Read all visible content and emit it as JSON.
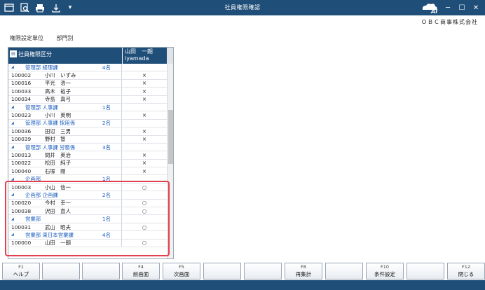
{
  "window": {
    "title": "社員権限確認"
  },
  "company_name": "ＯＢＣ商事株式会社",
  "setting": {
    "label": "権限設定単位",
    "value": "部門別"
  },
  "grid": {
    "header_left": "社員権限区分",
    "header_right_line1": "山田　一朗",
    "header_right_line2": "iyamada",
    "rows": [
      {
        "type": "group",
        "name": "管理部 経理課",
        "count": "4名",
        "mark": ""
      },
      {
        "type": "emp",
        "code": "100002",
        "name": "小川　いずみ",
        "mark": "×"
      },
      {
        "type": "emp",
        "code": "100016",
        "name": "平光　浩一",
        "mark": "×"
      },
      {
        "type": "emp",
        "code": "100033",
        "name": "高木　裕子",
        "mark": "×"
      },
      {
        "type": "emp",
        "code": "100034",
        "name": "寺島　真弓",
        "mark": "×"
      },
      {
        "type": "group",
        "name": "管理部 人事課",
        "count": "1名",
        "mark": ""
      },
      {
        "type": "emp",
        "code": "100023",
        "name": "小川　英明",
        "mark": "×"
      },
      {
        "type": "group",
        "name": "管理部 人事課 採用係",
        "count": "2名",
        "mark": ""
      },
      {
        "type": "emp",
        "code": "100036",
        "name": "田辺　三男",
        "mark": "×"
      },
      {
        "type": "emp",
        "code": "100039",
        "name": "野村　智",
        "mark": "×"
      },
      {
        "type": "group",
        "name": "管理部 人事課 労務係",
        "count": "3名",
        "mark": ""
      },
      {
        "type": "emp",
        "code": "100013",
        "name": "間井　英治",
        "mark": "×"
      },
      {
        "type": "emp",
        "code": "100022",
        "name": "松田　純子",
        "mark": "×"
      },
      {
        "type": "emp",
        "code": "100040",
        "name": "石塚　剛",
        "mark": "×"
      },
      {
        "type": "group",
        "name": "企画部",
        "count": "1名",
        "mark": ""
      },
      {
        "type": "emp",
        "code": "100003",
        "name": "小山　信一",
        "mark": "○"
      },
      {
        "type": "group",
        "name": "企画部 企画課",
        "count": "2名",
        "mark": ""
      },
      {
        "type": "emp",
        "code": "100020",
        "name": "今村　幸一",
        "mark": "○"
      },
      {
        "type": "emp",
        "code": "100038",
        "name": "沢田　直人",
        "mark": "○"
      },
      {
        "type": "group",
        "name": "営業部",
        "count": "1名",
        "mark": ""
      },
      {
        "type": "emp",
        "code": "100031",
        "name": "武山　昭夫",
        "mark": "○"
      },
      {
        "type": "group",
        "name": "営業部 東日本営業課",
        "count": "4名",
        "mark": ""
      },
      {
        "type": "emp",
        "code": "100000",
        "name": "山田　一朗",
        "mark": "○"
      }
    ]
  },
  "fkeys": [
    {
      "key": "F1",
      "label": "ヘルプ"
    },
    {
      "key": "",
      "label": ""
    },
    {
      "key": "",
      "label": ""
    },
    {
      "key": "F4",
      "label": "前画面"
    },
    {
      "key": "F5",
      "label": "次画面"
    },
    {
      "key": "",
      "label": ""
    },
    {
      "key": "",
      "label": ""
    },
    {
      "key": "F8",
      "label": "再集計"
    },
    {
      "key": "",
      "label": ""
    },
    {
      "key": "F10",
      "label": "条件設定"
    },
    {
      "key": "",
      "label": ""
    },
    {
      "key": "F12",
      "label": "閉じる"
    }
  ],
  "icons": [
    "window-icon",
    "search-icon",
    "print-icon",
    "export-icon",
    "dropdown-icon"
  ],
  "colors": {
    "titlebar": "#1f4e79",
    "group_text": "#1d5fbf",
    "highlight": "#e04050"
  }
}
